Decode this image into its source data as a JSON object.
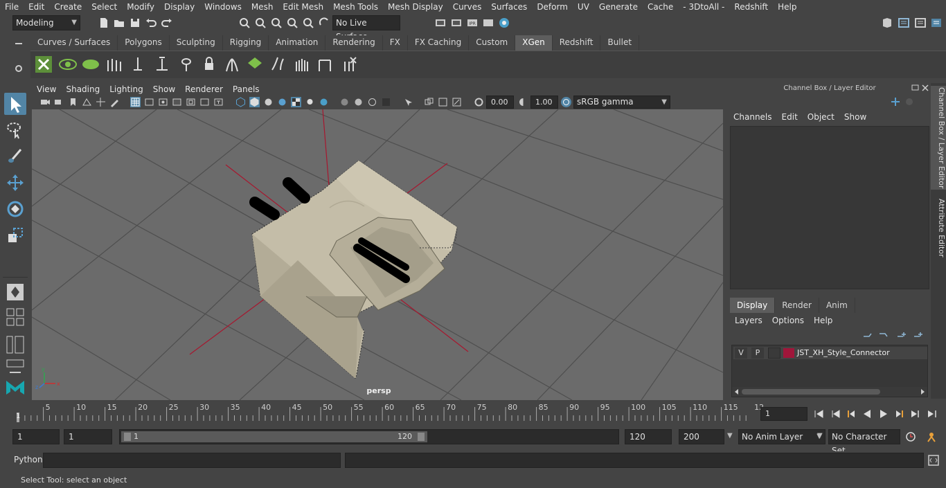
{
  "menubar": {
    "items": [
      "File",
      "Edit",
      "Create",
      "Select",
      "Modify",
      "Display",
      "Windows",
      "Mesh",
      "Edit Mesh",
      "Mesh Tools",
      "Mesh Display",
      "Curves",
      "Surfaces",
      "Deform",
      "UV",
      "Generate",
      "Cache",
      "- 3DtoAll -",
      "Redshift",
      "Help"
    ]
  },
  "statusline": {
    "mode": "Modeling",
    "live_surface": "No Live Surface"
  },
  "shelf": {
    "tabs": [
      "Curves / Surfaces",
      "Polygons",
      "Sculpting",
      "Rigging",
      "Animation",
      "Rendering",
      "FX",
      "FX Caching",
      "Custom",
      "XGen",
      "Redshift",
      "Bullet"
    ],
    "active_tab": "XGen"
  },
  "viewport": {
    "menus": [
      "View",
      "Shading",
      "Lighting",
      "Show",
      "Renderer",
      "Panels"
    ],
    "exposure": "0.00",
    "gamma": "1.00",
    "color_space": "sRGB gamma",
    "camera_label": "persp"
  },
  "rightpanel": {
    "title": "Channel Box / Layer Editor",
    "channel_menus": [
      "Channels",
      "Edit",
      "Object",
      "Show"
    ],
    "layer_tabs": [
      "Display",
      "Render",
      "Anim"
    ],
    "active_layer_tab": "Display",
    "layer_menus": [
      "Layers",
      "Options",
      "Help"
    ],
    "layer": {
      "visible": "V",
      "playback": "P",
      "name": "JST_XH_Style_Connector",
      "color": "#a0163a"
    },
    "side_tabs": [
      "Channel Box / Layer Editor",
      "Attribute Editor"
    ]
  },
  "timeline": {
    "ticks": [
      "5",
      "10",
      "15",
      "20",
      "25",
      "30",
      "35",
      "40",
      "45",
      "50",
      "55",
      "60",
      "65",
      "70",
      "75",
      "80",
      "85",
      "90",
      "95",
      "100",
      "105",
      "110",
      "115",
      "12"
    ],
    "start_marker": "1",
    "current_frame": "1"
  },
  "range": {
    "start": "1",
    "playback_start": "1",
    "slider_start": "1",
    "slider_end": "120",
    "playback_end": "120",
    "end": "200",
    "anim_layer": "No Anim Layer",
    "character_set": "No Character Set"
  },
  "cmdline": {
    "label": "Python"
  },
  "helpline": {
    "text": "Select Tool: select an object"
  },
  "colors": {
    "accent": "#5285a6",
    "viewport_bg": "#6b6b6b",
    "object": "#cfc8b4",
    "axis_line": "#a8162e"
  }
}
